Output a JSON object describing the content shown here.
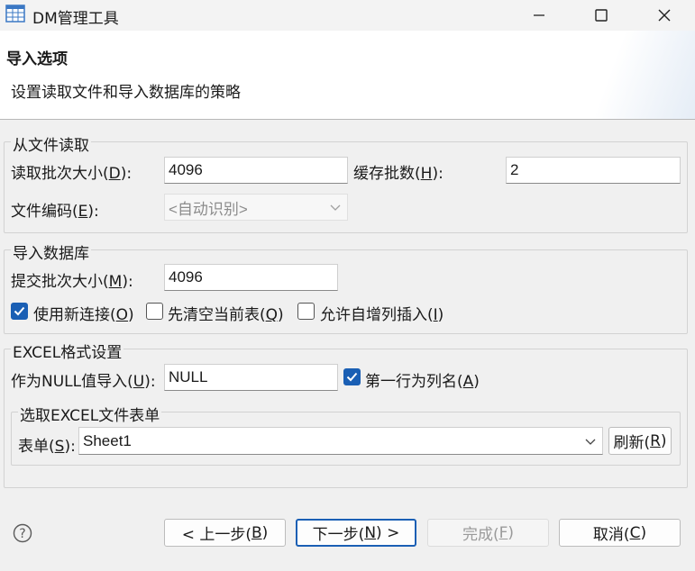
{
  "window": {
    "title": "DM管理工具",
    "minimize_icon": "minimize-icon",
    "maximize_icon": "maximize-icon",
    "close_icon": "close-icon"
  },
  "header": {
    "title": "导入选项",
    "description": "设置读取文件和导入数据库的策略"
  },
  "read_group": {
    "title": "从文件读取",
    "batch_size_label": "读取批次大小(",
    "batch_size_key": "D",
    "batch_size_value": "4096",
    "cache_label": "缓存批数(",
    "cache_key": "H",
    "cache_value": "2",
    "encoding_label": "文件编码(",
    "encoding_key": "E",
    "encoding_value": "<自动识别>"
  },
  "import_group": {
    "title": "导入数据库",
    "commit_label": "提交批次大小(",
    "commit_key": "M",
    "commit_value": "4096",
    "new_conn_label": "使用新连接(",
    "new_conn_key": "O",
    "new_conn_checked": true,
    "clear_table_label": "先清空当前表(",
    "clear_table_key": "Q",
    "clear_table_checked": false,
    "identity_label": "允许自增列插入(",
    "identity_key": "I",
    "identity_checked": false
  },
  "excel_group": {
    "title": "EXCEL格式设置",
    "null_label": "作为NULL值导入(",
    "null_key": "U",
    "null_value": "NULL",
    "first_row_label": "第一行为列名(",
    "first_row_key": "A",
    "first_row_checked": true,
    "sheet_group_title": "选取EXCEL文件表单",
    "sheet_label": "表单(",
    "sheet_key": "S",
    "sheet_value": "Sheet1",
    "refresh_label": "刷新(",
    "refresh_key": "R"
  },
  "footer": {
    "help_icon": "help-icon",
    "back_label": "< 上一步(",
    "back_key": "B",
    "next_label": "下一步(",
    "next_key": "N",
    "next_suffix": ") >",
    "finish_label": "完成(",
    "finish_key": "F",
    "cancel_label": "取消(",
    "cancel_key": "C"
  },
  "close_paren": "):",
  "paren": ")",
  "colors": {
    "accent": "#1a5fb4"
  }
}
